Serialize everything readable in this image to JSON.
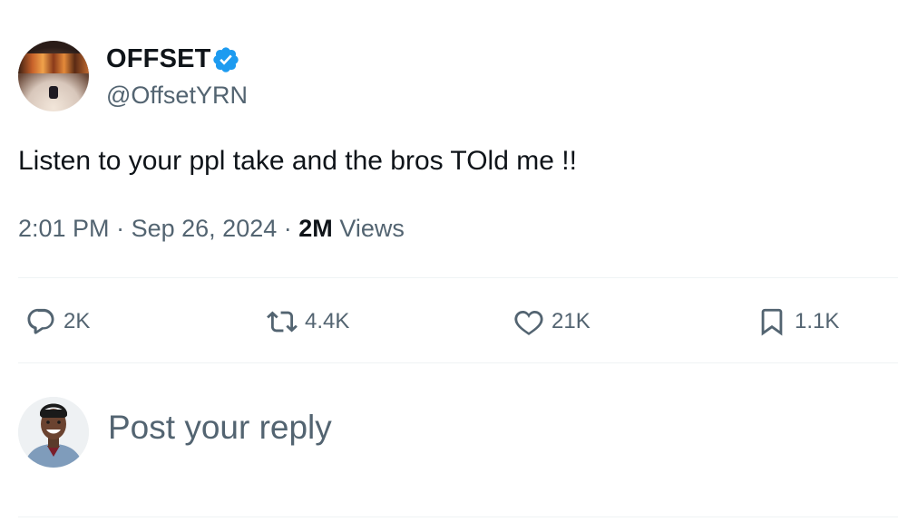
{
  "author": {
    "name": "OFFSET",
    "handle": "@OffsetYRN",
    "verified": true,
    "verified_color": "#1d9bf0"
  },
  "tweet": {
    "text": "Listen to your ppl take and the bros TOld me !!",
    "time": "2:01 PM",
    "date": "Sep 26, 2024",
    "separator": "·",
    "views_count": "2M",
    "views_label": "Views"
  },
  "actions": {
    "replies": "2K",
    "reposts": "4.4K",
    "likes": "21K",
    "bookmarks": "1.1K"
  },
  "reply": {
    "placeholder": "Post your reply"
  },
  "icons": [
    "reply-icon",
    "repost-icon",
    "like-icon",
    "bookmark-icon",
    "verified-badge-icon"
  ],
  "colors": {
    "text_primary": "#0f1419",
    "text_secondary": "#536471",
    "divider": "#eff3f4"
  }
}
